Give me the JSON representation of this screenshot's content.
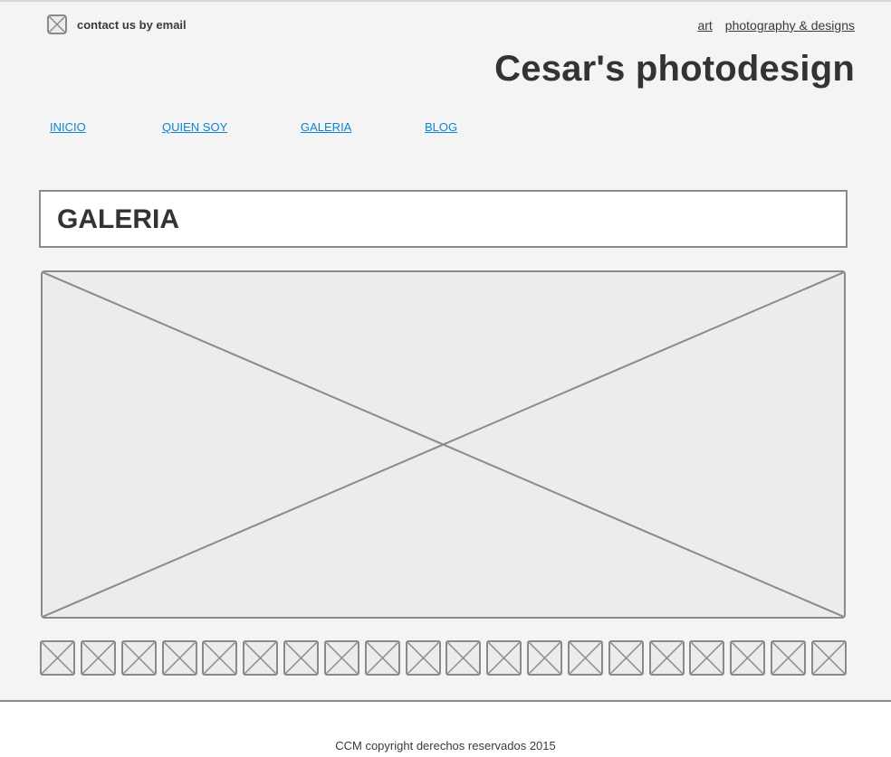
{
  "header": {
    "contact": {
      "icon": "mail-icon",
      "label": "contact us by email"
    },
    "top_links": [
      {
        "label": "art"
      },
      {
        "label": "photography & designs"
      }
    ],
    "site_title": "Cesar's photodesign"
  },
  "nav": {
    "items": [
      {
        "label": "INICIO"
      },
      {
        "label": "QUIEN SOY"
      },
      {
        "label": "GALERIA"
      },
      {
        "label": "BLOG"
      }
    ]
  },
  "main": {
    "section_title": "GALERIA",
    "image_placeholder": "image-placeholder-icon",
    "thumbnail_count": 20
  },
  "footer": {
    "copyright": "CCM copyright derechos reservados 2015"
  },
  "colors": {
    "page_background": "#f4f4f4",
    "placeholder_fill": "#ececec",
    "placeholder_stroke": "#8a8a8a",
    "link_blue": "#0a86d0",
    "text_dark": "#333333"
  }
}
